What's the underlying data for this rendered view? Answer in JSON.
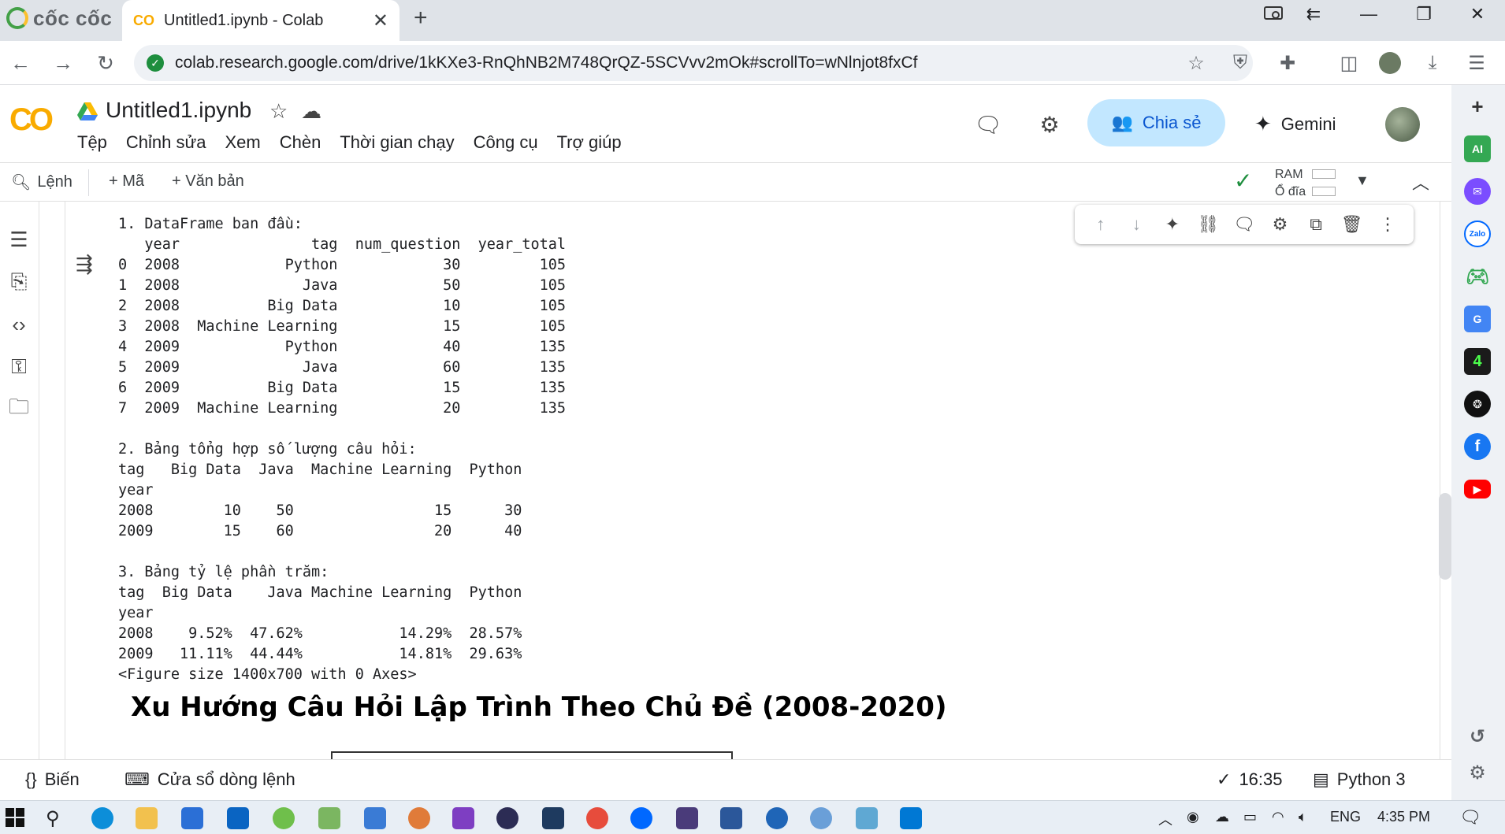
{
  "browser": {
    "brand": "cốc cốc",
    "tab_logo": "CO",
    "tab_title": "Untitled1.ipynb - Colab",
    "url": "colab.research.google.com/drive/1kKXe3-RnQhNB2M748QrQZ-5SCVvv2mOk#scrollTo=wNlnjot8fxCf"
  },
  "colab": {
    "logo": "CO",
    "title": "Untitled1.ipynb",
    "menu": [
      "Tệp",
      "Chỉnh sửa",
      "Xem",
      "Chèn",
      "Thời gian chạy",
      "Công cụ",
      "Trợ giúp"
    ],
    "share_label": "Chia sẻ",
    "gemini_label": "Gemini"
  },
  "toolbar": {
    "command": "Lệnh",
    "add_code": "+ Mã",
    "add_text": "+ Văn bản",
    "ram_label": "RAM",
    "disk_label": "Ổ đĩa"
  },
  "output": {
    "text": "1. DataFrame ban đầu:\n   year               tag  num_question  year_total\n0  2008            Python            30         105\n1  2008              Java            50         105\n2  2008          Big Data            10         105\n3  2008  Machine Learning            15         105\n4  2009            Python            40         135\n5  2009              Java            60         135\n6  2009          Big Data            15         135\n7  2009  Machine Learning            20         135\n\n2. Bảng tổng hợp số lượng câu hỏi:\ntag   Big Data  Java  Machine Learning  Python\nyear\n2008        10    50                15      30\n2009        15    60                20      40\n\n3. Bảng tỷ lệ phần trăm:\ntag  Big Data    Java Machine Learning  Python\nyear\n2008    9.52%  47.62%           14.29%  28.57%\n2009   11.11%  44.44%           14.81%  29.63%\n<Figure size 1400x700 with 0 Axes>",
    "figure_title": "Xu Hướng Câu Hỏi Lập Trình Theo Chủ Đề (2008-2020)"
  },
  "statusbar": {
    "variables": "Biến",
    "terminal": "Cửa sổ dòng lệnh",
    "time": "16:35",
    "runtime": "Python 3"
  },
  "taskbar": {
    "lang": "ENG",
    "clock": "4:35 PM"
  },
  "colors": {
    "accent": "#0b57d0",
    "share_bg": "#c2e7ff",
    "colab_orange": "#f9ab00",
    "ok_green": "#1e8e3e"
  }
}
